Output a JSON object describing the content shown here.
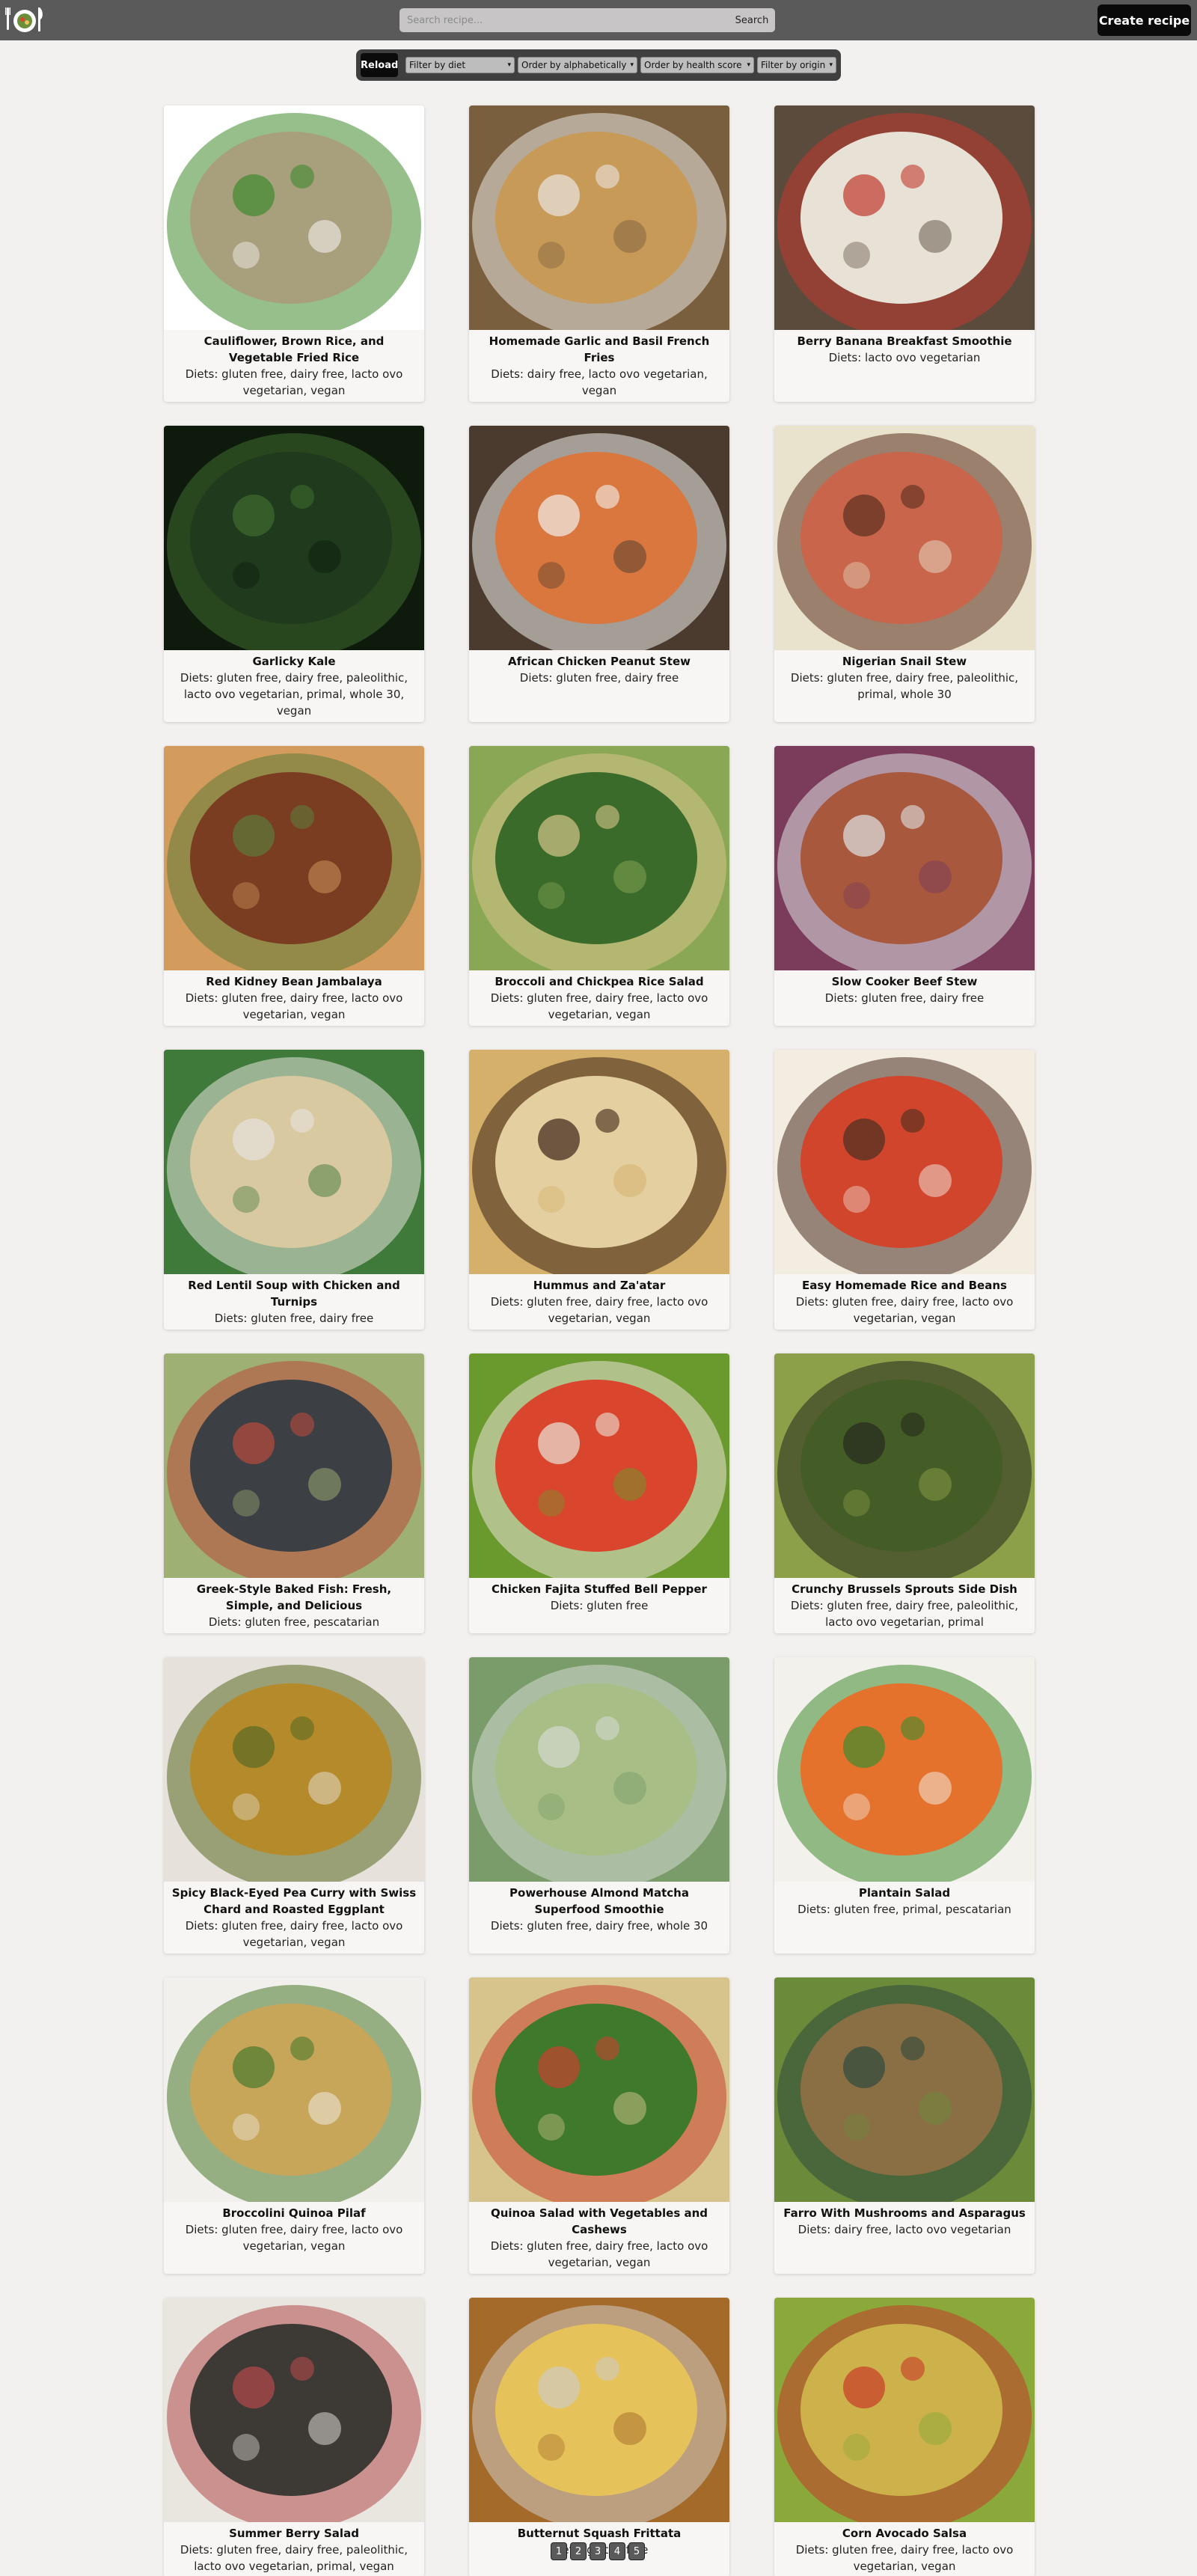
{
  "header": {
    "search_placeholder": "Search recipe...",
    "search_button": "Search",
    "create_button": "Create recipe",
    "logo_icon": "plate-fork-knife-logo"
  },
  "filters": {
    "reload": "Reload",
    "diet": "Filter by diet",
    "alpha": "Order by alphabetically",
    "health": "Order by health score",
    "origin": "Filter by origin"
  },
  "recipes": [
    {
      "title": "Cauliflower, Brown Rice, and Vegetable Fried Rice",
      "diets": "Diets: gluten free, dairy free, lacto ovo vegetarian, vegan",
      "colors": [
        "#a89f7d",
        "#3f8a2e",
        "#ffffff"
      ]
    },
    {
      "title": "Homemade Garlic and Basil French Fries",
      "diets": "Diets: dairy free, lacto ovo vegetarian, vegan",
      "colors": [
        "#c79a58",
        "#e9e6e2",
        "#7a5f3e"
      ]
    },
    {
      "title": "Berry Banana Breakfast Smoothie",
      "diets": "Diets: lacto ovo vegetarian",
      "colors": [
        "#e8e2d6",
        "#c13a2d",
        "#5a4b3d"
      ]
    },
    {
      "title": "Garlicky Kale",
      "diets": "Diets: gluten free, dairy free, paleolithic, lacto ovo vegetarian, primal, whole 30, vegan",
      "colors": [
        "#1f3a1c",
        "#3e6b2f",
        "#0e1b0c"
      ]
    },
    {
      "title": "African Chicken Peanut Stew",
      "diets": "Diets: gluten free, dairy free",
      "colors": [
        "#d9773f",
        "#f1f0ec",
        "#4a3b2e"
      ]
    },
    {
      "title": "Nigerian Snail Stew",
      "diets": "Diets: gluten free, dairy free, paleolithic, primal, whole 30",
      "colors": [
        "#c8654a",
        "#5a2f1f",
        "#e9e2cc"
      ]
    },
    {
      "title": "Red Kidney Bean Jambalaya",
      "diets": "Diets: gluten free, dairy free, lacto ovo vegetarian, vegan",
      "colors": [
        "#7a3d22",
        "#5e7a3b",
        "#d39c5c"
      ]
    },
    {
      "title": "Broccoli and Chickpea Rice Salad",
      "diets": "Diets: gluten free, dairy free, lacto ovo vegetarian, vegan",
      "colors": [
        "#3b6b2a",
        "#d6c58a",
        "#8aa755"
      ]
    },
    {
      "title": "Slow Cooker Beef Stew",
      "diets": "Diets: gluten free, dairy free",
      "colors": [
        "#a7583d",
        "#dfe2e6",
        "#7b3b5a"
      ]
    },
    {
      "title": "Red Lentil Soup with Chicken and Turnips",
      "diets": "Diets: gluten free, dairy free",
      "colors": [
        "#d9c9a1",
        "#e6e3dd",
        "#3f7a3a"
      ]
    },
    {
      "title": "Hummus and Za'atar",
      "diets": "Diets: gluten free, dairy free, lacto ovo vegetarian, vegan",
      "colors": [
        "#e3cf9f",
        "#3a2418",
        "#d4b06a"
      ]
    },
    {
      "title": "Easy Homemade Rice and Beans",
      "diets": "Diets: gluten free, dairy free, lacto ovo vegetarian, vegan",
      "colors": [
        "#d1452c",
        "#4a3022",
        "#f3ece0"
      ]
    },
    {
      "title": "Greek-Style Baked Fish: Fresh, Simple, and Delicious",
      "diets": "Diets: gluten free, pescatarian",
      "colors": [
        "#3c4045",
        "#b94a3c",
        "#9fb074"
      ]
    },
    {
      "title": "Chicken Fajita Stuffed Bell Pepper",
      "diets": "Diets: gluten free",
      "colors": [
        "#d9462d",
        "#e9e2d7",
        "#6a9a2e"
      ]
    },
    {
      "title": "Crunchy Brussels Sprouts Side Dish",
      "diets": "Diets: gluten free, dairy free, paleolithic, lacto ovo vegetarian, primal",
      "colors": [
        "#445c25",
        "#262a1e",
        "#8ca04a"
      ]
    },
    {
      "title": "Spicy Black-Eyed Pea Curry with Swiss Chard and Roasted Eggplant",
      "diets": "Diets: gluten free, dairy free, lacto ovo vegetarian, vegan",
      "colors": [
        "#b48a2a",
        "#5a6b25",
        "#e6e1da"
      ]
    },
    {
      "title": "Powerhouse Almond Matcha Superfood Smoothie",
      "diets": "Diets: gluten free, dairy free, whole 30",
      "colors": [
        "#a9be86",
        "#d4d9cf",
        "#7a9c6a"
      ]
    },
    {
      "title": "Plantain Salad",
      "diets": "Diets: gluten free, primal, pescatarian",
      "colors": [
        "#e4722c",
        "#3f8a2e",
        "#f3f1ec"
      ]
    },
    {
      "title": "Broccolini Quinoa Pilaf",
      "diets": "Diets: gluten free, dairy free, lacto ovo vegetarian, vegan",
      "colors": [
        "#c7a65a",
        "#4a7a2c",
        "#f1f0ec"
      ]
    },
    {
      "title": "Quinoa Salad with Vegetables and Cashews",
      "diets": "Diets: gluten free, dairy free, lacto ovo vegetarian, vegan",
      "colors": [
        "#3f7a2c",
        "#c8412e",
        "#d7c48c"
      ]
    },
    {
      "title": "Farro With Mushrooms and Asparagus",
      "diets": "Diets: dairy free, lacto ovo vegetarian",
      "colors": [
        "#8a6f45",
        "#2e4a3c",
        "#6b8a3a"
      ]
    },
    {
      "title": "Summer Berry Salad",
      "diets": "Diets: gluten free, dairy free, paleolithic, lacto ovo vegetarian, primal, vegan",
      "colors": [
        "#3d3a36",
        "#b34a4a",
        "#e9e6e0"
      ]
    },
    {
      "title": "Butternut Squash Frittata",
      "diets": "Diets: gluten free",
      "colors": [
        "#e6c35a",
        "#cfcac2",
        "#a36a2a"
      ]
    },
    {
      "title": "Corn Avocado Salsa",
      "diets": "Diets: gluten free, dairy free, lacto ovo vegetarian, vegan",
      "colors": [
        "#cdb14a",
        "#c73a2a",
        "#8aa93a"
      ]
    }
  ],
  "pagination": [
    "1",
    "2",
    "3",
    "4",
    "5"
  ]
}
